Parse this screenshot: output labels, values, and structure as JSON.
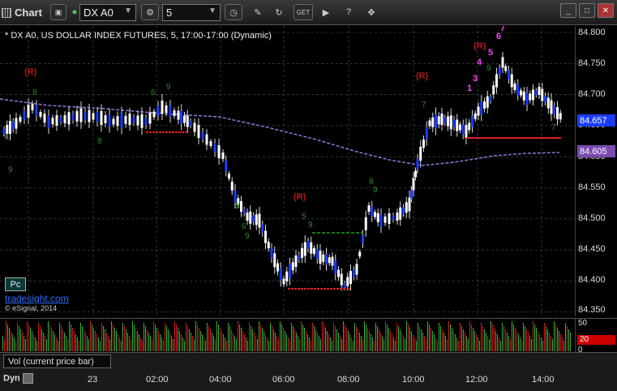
{
  "toolbar": {
    "title": "Chart",
    "symbol": "DX A0",
    "interval": "5",
    "badge": "GET"
  },
  "chart_info": "* DX A0, US DOLLAR INDEX FUTURES, 5, 17:00-17:00 (Dynamic)",
  "price_axis": [
    "84.800",
    "84.750",
    "84.700",
    "84.650",
    "84.600",
    "84.550",
    "84.500",
    "84.450",
    "84.400",
    "84.350"
  ],
  "last_price": "84.657",
  "ma_price": "84.605",
  "last_price_color": "#1b3cff",
  "ma_price_color": "#7a4ab0",
  "pc_label": "Pc",
  "brand_link": "tradesight.com",
  "copyright": "© eSignal, 2014",
  "volume": {
    "title": "Vol (current price bar)",
    "scale_top": "50",
    "scale_bottom": "0",
    "current": "20"
  },
  "time_axis": [
    "23",
    "02:00",
    "04:00",
    "06:00",
    "08:00",
    "10:00",
    "12:00",
    "14:00"
  ],
  "bottom_label": "Dyn",
  "chart_data": {
    "type": "candlestick",
    "y_range": [
      84.35,
      84.8
    ],
    "price_ticks": [
      84.35,
      84.4,
      84.45,
      84.5,
      84.55,
      84.6,
      84.65,
      84.7,
      84.75,
      84.8
    ],
    "setup_markers": [
      "(R)",
      "(R)",
      "(R)",
      "(R)",
      "1",
      "3",
      "4",
      "5",
      "6",
      "7"
    ],
    "levels": [
      84.7,
      84.5,
      84.38,
      84.63,
      84.605
    ]
  }
}
